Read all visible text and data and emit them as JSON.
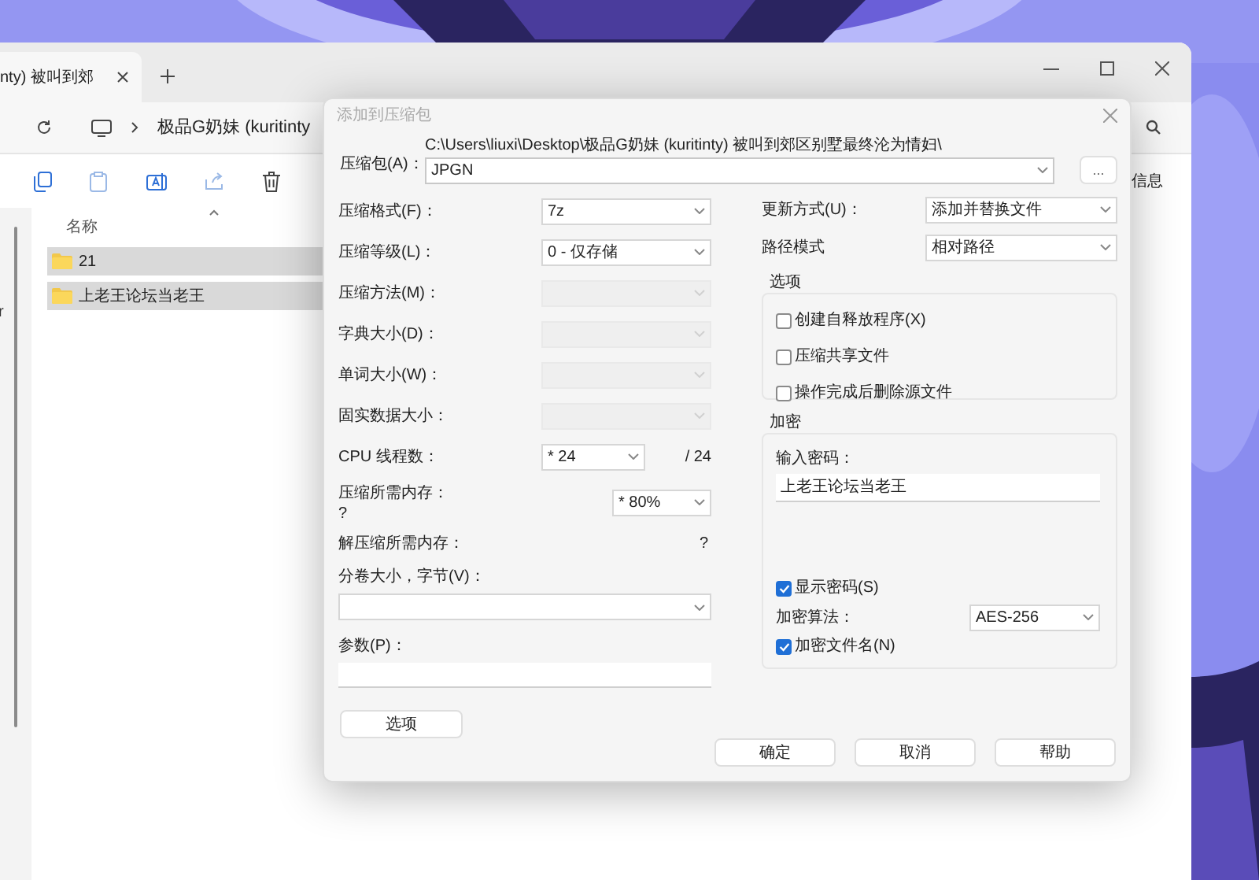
{
  "explorer": {
    "tab_title": "nty) 被叫到郊",
    "breadcrumb": "极品G奶妹 (kuritinty",
    "toolbar_label": "信息",
    "sidebar_text": "r",
    "column": "名称",
    "rows": [
      {
        "name": "21",
        "selected": true
      },
      {
        "name": "上老王论坛当老王",
        "selected": true
      }
    ]
  },
  "dialog": {
    "title": "添加到压缩包",
    "archive": {
      "label": "压缩包(A)：",
      "path": "C:\\Users\\liuxi\\Desktop\\极品G奶妹 (kuritinty) 被叫到郊区别墅最终沦为情妇\\",
      "value": "JPGN",
      "browse": "..."
    },
    "left_fields": [
      {
        "kind": "select",
        "label": "压缩格式(F)：",
        "value": "7z",
        "disabled": false
      },
      {
        "kind": "select",
        "label": "压缩等级(L)：",
        "value": "0 - 仅存储",
        "disabled": false
      },
      {
        "kind": "select",
        "label": "压缩方法(M)：",
        "disabled": true
      },
      {
        "kind": "select",
        "label": "字典大小(D)：",
        "disabled": true
      },
      {
        "kind": "select",
        "label": "单词大小(W)：",
        "disabled": true
      },
      {
        "kind": "select",
        "label": "固实数据大小：",
        "disabled": true
      },
      {
        "kind": "threads",
        "label": "CPU 线程数：",
        "value": "* 24",
        "total": "/ 24"
      },
      {
        "kind": "memory",
        "label": "压缩所需内存：",
        "note": "?",
        "value": "* 80%"
      },
      {
        "kind": "info",
        "label": "解压缩所需内存：",
        "value": "?"
      },
      {
        "kind": "combo",
        "label": "分卷大小，字节(V)："
      },
      {
        "kind": "text",
        "label": "参数(P)："
      }
    ],
    "options_button": "选项",
    "right_fields": [
      {
        "label": "更新方式(U)：",
        "value": "添加并替换文件"
      },
      {
        "label": "路径模式",
        "value": "相对路径"
      }
    ],
    "options": {
      "title": "选项",
      "items": [
        {
          "label": "创建自释放程序(X)",
          "checked": false
        },
        {
          "label": "压缩共享文件",
          "checked": false
        },
        {
          "label": "操作完成后删除源文件",
          "checked": false
        }
      ]
    },
    "encryption": {
      "title": "加密",
      "password_label": "输入密码：",
      "password": "上老王论坛当老王",
      "show_password": {
        "label": "显示密码(S)",
        "checked": true
      },
      "method_label": "加密算法：",
      "method": "AES-256",
      "encrypt_names": {
        "label": "加密文件名(N)",
        "checked": true
      }
    },
    "buttons": [
      "确定",
      "取消",
      "帮助"
    ]
  }
}
